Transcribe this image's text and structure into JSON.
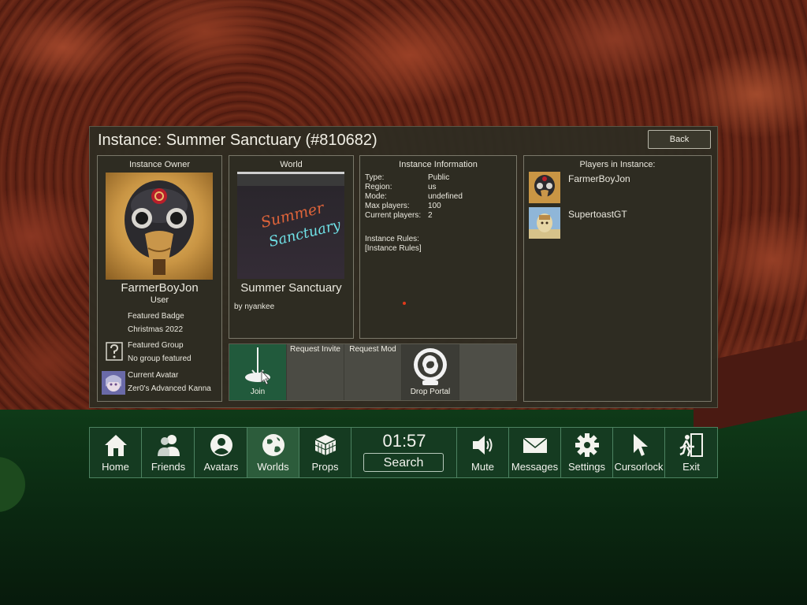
{
  "panel": {
    "title": "Instance: Summer Sanctuary (#810682)",
    "back_label": "Back"
  },
  "owner": {
    "header": "Instance Owner",
    "name": "FarmerBoyJon",
    "role": "User",
    "badge_label": "Featured Badge",
    "badge_value": "Christmas 2022",
    "group_label": "Featured Group",
    "group_value": "No group featured",
    "avatar_label": "Current Avatar",
    "avatar_value": "Zer0's Advanced Kanna"
  },
  "world": {
    "header": "World",
    "name": "Summer Sanctuary",
    "author": "by nyankee",
    "thumb_text_1": "Summer",
    "thumb_text_2": "Sanctuary"
  },
  "instance_info": {
    "header": "Instance Information",
    "rows": [
      {
        "key": "Type:",
        "value": "Public"
      },
      {
        "key": "Region:",
        "value": "us"
      },
      {
        "key": "Mode:",
        "value": "undefined"
      },
      {
        "key": "Max players:",
        "value": "100"
      },
      {
        "key": "Current players:",
        "value": "2"
      }
    ],
    "rules_label": "Instance Rules:",
    "rules_value": "[Instance Rules]"
  },
  "actions": {
    "join": "Join",
    "request_invite": "Request Invite",
    "request_mod": "Request Mod",
    "drop_portal": "Drop Portal"
  },
  "players": {
    "header": "Players in Instance:",
    "list": [
      {
        "name": "FarmerBoyJon"
      },
      {
        "name": "SupertoastGT"
      }
    ]
  },
  "dock": {
    "home": "Home",
    "friends": "Friends",
    "avatars": "Avatars",
    "worlds": "Worlds",
    "props": "Props",
    "clock": "01:57",
    "search": "Search",
    "mute": "Mute",
    "messages": "Messages",
    "settings": "Settings",
    "cursorlock": "Cursorlock",
    "exit": "Exit",
    "active_tab": "Worlds"
  },
  "colors": {
    "panel_bg": "#2e2c22",
    "join_bg": "#215a3c",
    "dock_bg": "#153b21",
    "dock_active": "#2c5c3b"
  }
}
